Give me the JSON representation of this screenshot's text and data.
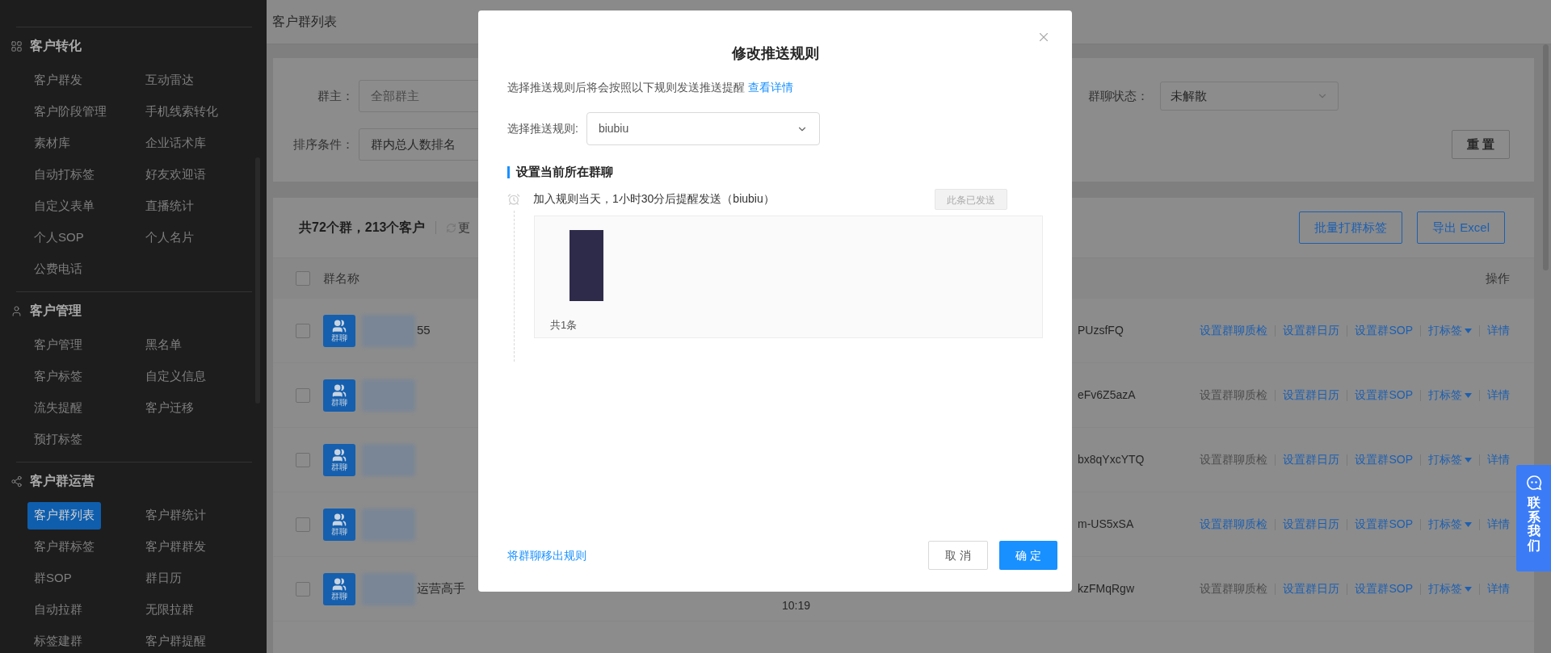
{
  "sidebar": {
    "sections": [
      {
        "title": "客户转化",
        "items": [
          {
            "label": "客户群发",
            "selected": false
          },
          {
            "label": "互动雷达",
            "selected": false
          },
          {
            "label": "客户阶段管理",
            "selected": false
          },
          {
            "label": "手机线索转化",
            "selected": false
          },
          {
            "label": "素材库",
            "selected": false
          },
          {
            "label": "企业话术库",
            "selected": false
          },
          {
            "label": "自动打标签",
            "selected": false
          },
          {
            "label": "好友欢迎语",
            "selected": false
          },
          {
            "label": "自定义表单",
            "selected": false
          },
          {
            "label": "直播统计",
            "selected": false
          },
          {
            "label": "个人SOP",
            "selected": false
          },
          {
            "label": "个人名片",
            "selected": false
          },
          {
            "label": "公费电话",
            "selected": false
          }
        ]
      },
      {
        "title": "客户管理",
        "items": [
          {
            "label": "客户管理",
            "selected": false
          },
          {
            "label": "黑名单",
            "selected": false
          },
          {
            "label": "客户标签",
            "selected": false
          },
          {
            "label": "自定义信息",
            "selected": false
          },
          {
            "label": "流失提醒",
            "selected": false
          },
          {
            "label": "客户迁移",
            "selected": false
          },
          {
            "label": "预打标签",
            "selected": false
          }
        ]
      },
      {
        "title": "客户群运营",
        "items": [
          {
            "label": "客户群列表",
            "selected": true
          },
          {
            "label": "客户群统计",
            "selected": false
          },
          {
            "label": "客户群标签",
            "selected": false
          },
          {
            "label": "客户群群发",
            "selected": false
          },
          {
            "label": "群SOP",
            "selected": false
          },
          {
            "label": "群日历",
            "selected": false
          },
          {
            "label": "自动拉群",
            "selected": false
          },
          {
            "label": "无限拉群",
            "selected": false
          },
          {
            "label": "标签建群",
            "selected": false
          },
          {
            "label": "客户群提醒",
            "selected": false
          }
        ]
      }
    ]
  },
  "page": {
    "title": "客户群列表"
  },
  "filters": {
    "rows": [
      {
        "left": {
          "label": "群主：",
          "placeholder": "全部群主"
        },
        "right": {
          "label": "群聊状态：",
          "value": "未解散"
        }
      },
      {
        "left": {
          "label": "排序条件：",
          "value": "群内总人数排名"
        }
      }
    ],
    "reset_button": "重 置"
  },
  "summary": {
    "text": "共72个群，213个客户",
    "refresh_label": "更"
  },
  "toolbar_buttons": [
    "批量打群标签",
    "导出 Excel"
  ],
  "table": {
    "columns": [
      "群名称",
      "操作"
    ],
    "header_checked": false,
    "rows": [
      {
        "checked": false,
        "avatar_label": "群聊",
        "name": "55",
        "id": "PUzsfFQ",
        "actions": [
          {
            "kind": "link",
            "label": "设置群聊质检",
            "disabled": false
          },
          {
            "kind": "link",
            "label": "设置群日历",
            "disabled": false
          },
          {
            "kind": "link",
            "label": "设置群SOP",
            "disabled": false
          },
          {
            "kind": "dropdown",
            "label": "打标签",
            "disabled": false
          },
          {
            "kind": "link",
            "label": "详情",
            "disabled": false
          }
        ]
      },
      {
        "checked": false,
        "avatar_label": "群聊",
        "id": "eFv6Z5azA",
        "actions": [
          {
            "kind": "link",
            "label": "设置群聊质检",
            "disabled": true
          },
          {
            "kind": "link",
            "label": "设置群日历",
            "disabled": false
          },
          {
            "kind": "link",
            "label": "设置群SOP",
            "disabled": false
          },
          {
            "kind": "dropdown",
            "label": "打标签",
            "disabled": false
          },
          {
            "kind": "link",
            "label": "详情",
            "disabled": false
          }
        ]
      },
      {
        "checked": false,
        "avatar_label": "群聊",
        "id": "bx8qYxcYTQ",
        "actions": [
          {
            "kind": "link",
            "label": "设置群聊质检",
            "disabled": true
          },
          {
            "kind": "link",
            "label": "设置群日历",
            "disabled": false
          },
          {
            "kind": "link",
            "label": "设置群SOP",
            "disabled": false
          },
          {
            "kind": "dropdown",
            "label": "打标签",
            "disabled": false
          },
          {
            "kind": "link",
            "label": "详情",
            "disabled": false
          }
        ]
      },
      {
        "checked": false,
        "avatar_label": "群聊",
        "id": "m-US5xSA",
        "actions": [
          {
            "kind": "link",
            "label": "设置群聊质检",
            "disabled": false
          },
          {
            "kind": "link",
            "label": "设置群日历",
            "disabled": false
          },
          {
            "kind": "link",
            "label": "设置群SOP",
            "disabled": false
          },
          {
            "kind": "dropdown",
            "label": "打标签",
            "disabled": false
          },
          {
            "kind": "link",
            "label": "详情",
            "disabled": false
          }
        ]
      },
      {
        "checked": false,
        "avatar_label": "群聊",
        "name": "运营高手",
        "time": "10:19",
        "id": "kzFMqRgw",
        "actions": [
          {
            "kind": "link",
            "label": "设置群聊质检",
            "disabled": true
          },
          {
            "kind": "link",
            "label": "设置群日历",
            "disabled": false
          },
          {
            "kind": "link",
            "label": "设置群SOP",
            "disabled": false
          },
          {
            "kind": "dropdown",
            "label": "打标签",
            "disabled": false
          },
          {
            "kind": "link",
            "label": "详情",
            "disabled": false
          }
        ]
      }
    ]
  },
  "modal": {
    "title": "修改推送规则",
    "description": "选择推送规则后将会按照以下规则发送推送提醒",
    "details_link": "查看详情",
    "select_label": "选择推送规则:",
    "select_value": "biubiu",
    "section_title": "设置当前所在群聊",
    "rules": [
      {
        "text": "加入规则当天，1小时30分后提醒发送（biubiu）",
        "status": "此条已发送",
        "count": "共1条"
      }
    ],
    "remove_link": "将群聊移出规则",
    "cancel_button": "取 消",
    "confirm_button": "确 定"
  },
  "contact_button": "联系我们"
}
